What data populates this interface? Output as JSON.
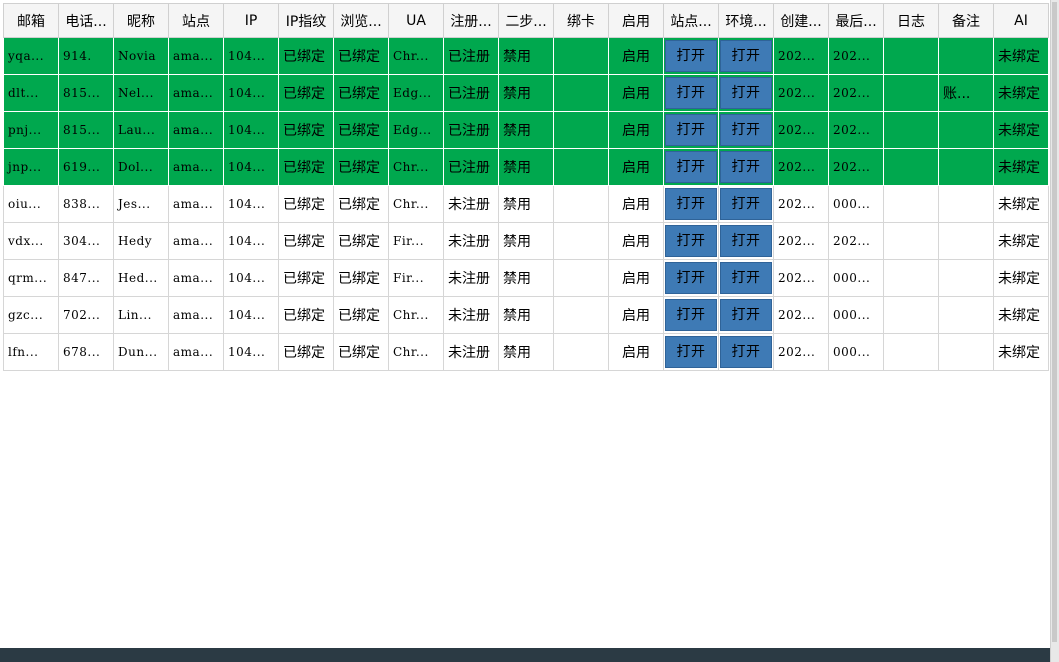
{
  "columns": [
    "邮箱",
    "电话...",
    "昵称",
    "站点",
    "IP",
    "IP指纹",
    "浏览...",
    "UA",
    "注册...",
    "二步...",
    "绑卡",
    "启用",
    "站点...",
    "环境...",
    "创建...",
    "最后...",
    "日志",
    "备注",
    "AI"
  ],
  "rows": [
    {
      "style": "bound",
      "email": "yqa...",
      "phone": "914.",
      "nick": "Novia",
      "site": "ama...",
      "ip": "104...",
      "ipfp": "已绑定",
      "browser": "已绑定",
      "ua": "Chr...",
      "reg": "已注册",
      "twostep": "禁用",
      "card": "",
      "enable": "启用",
      "site_btn": "打开",
      "env_btn": "打开",
      "created": "202...",
      "last": "202...",
      "log": "",
      "note": "",
      "ai": "未绑定"
    },
    {
      "style": "bound",
      "email": "dlt...",
      "phone": "815...",
      "nick": "Nel...",
      "site": "ama...",
      "ip": "104...",
      "ipfp": "已绑定",
      "browser": "已绑定",
      "ua": "Edg...",
      "reg": "已注册",
      "twostep": "禁用",
      "card": "",
      "enable": "启用",
      "site_btn": "打开",
      "env_btn": "打开",
      "created": "202...",
      "last": "202...",
      "log": "",
      "note": "账...",
      "ai": "未绑定"
    },
    {
      "style": "bound",
      "email": "pnj...",
      "phone": "815...",
      "nick": "Lau...",
      "site": "ama...",
      "ip": "104...",
      "ipfp": "已绑定",
      "browser": "已绑定",
      "ua": "Edg...",
      "reg": "已注册",
      "twostep": "禁用",
      "card": "",
      "enable": "启用",
      "site_btn": "打开",
      "env_btn": "打开",
      "created": "202...",
      "last": "202...",
      "log": "",
      "note": "",
      "ai": "未绑定"
    },
    {
      "style": "bound",
      "email": "jnp...",
      "phone": "619...",
      "nick": "Dol...",
      "site": "ama...",
      "ip": "104...",
      "ipfp": "已绑定",
      "browser": "已绑定",
      "ua": "Chr...",
      "reg": "已注册",
      "twostep": "禁用",
      "card": "",
      "enable": "启用",
      "site_btn": "打开",
      "env_btn": "打开",
      "created": "202...",
      "last": "202...",
      "log": "",
      "note": "",
      "ai": "未绑定"
    },
    {
      "style": "unbound",
      "email": "oiu...",
      "phone": "838...",
      "nick": "Jes...",
      "site": "ama...",
      "ip": "104...",
      "ipfp": "已绑定",
      "browser": "已绑定",
      "ua": "Chr...",
      "reg": "未注册",
      "twostep": "禁用",
      "card": "",
      "enable": "启用",
      "site_btn": "打开",
      "env_btn": "打开",
      "created": "202...",
      "last": "000...",
      "log": "",
      "note": "",
      "ai": "未绑定"
    },
    {
      "style": "unbound",
      "email": "vdx...",
      "phone": "304...",
      "nick": "Hedy",
      "site": "ama...",
      "ip": "104...",
      "ipfp": "已绑定",
      "browser": "已绑定",
      "ua": "Fir...",
      "reg": "未注册",
      "twostep": "禁用",
      "card": "",
      "enable": "启用",
      "site_btn": "打开",
      "env_btn": "打开",
      "created": "202...",
      "last": "202...",
      "log": "",
      "note": "",
      "ai": "未绑定"
    },
    {
      "style": "unbound",
      "email": "qrm...",
      "phone": "847...",
      "nick": "Hed...",
      "site": "ama...",
      "ip": "104...",
      "ipfp": "已绑定",
      "browser": "已绑定",
      "ua": "Fir...",
      "reg": "未注册",
      "twostep": "禁用",
      "card": "",
      "enable": "启用",
      "site_btn": "打开",
      "env_btn": "打开",
      "created": "202...",
      "last": "000...",
      "log": "",
      "note": "",
      "ai": "未绑定"
    },
    {
      "style": "unbound",
      "email": "gzc...",
      "phone": "702...",
      "nick": "Lin...",
      "site": "ama...",
      "ip": "104...",
      "ipfp": "已绑定",
      "browser": "已绑定",
      "ua": "Chr...",
      "reg": "未注册",
      "twostep": "禁用",
      "card": "",
      "enable": "启用",
      "site_btn": "打开",
      "env_btn": "打开",
      "created": "202...",
      "last": "000...",
      "log": "",
      "note": "",
      "ai": "未绑定"
    },
    {
      "style": "unbound",
      "email": "lfn...",
      "phone": "678...",
      "nick": "Dun...",
      "site": "ama...",
      "ip": "104...",
      "ipfp": "已绑定",
      "browser": "已绑定",
      "ua": "Chr...",
      "reg": "未注册",
      "twostep": "禁用",
      "card": "",
      "enable": "启用",
      "site_btn": "打开",
      "env_btn": "打开",
      "created": "202...",
      "last": "000...",
      "log": "",
      "note": "",
      "ai": "未绑定"
    }
  ]
}
